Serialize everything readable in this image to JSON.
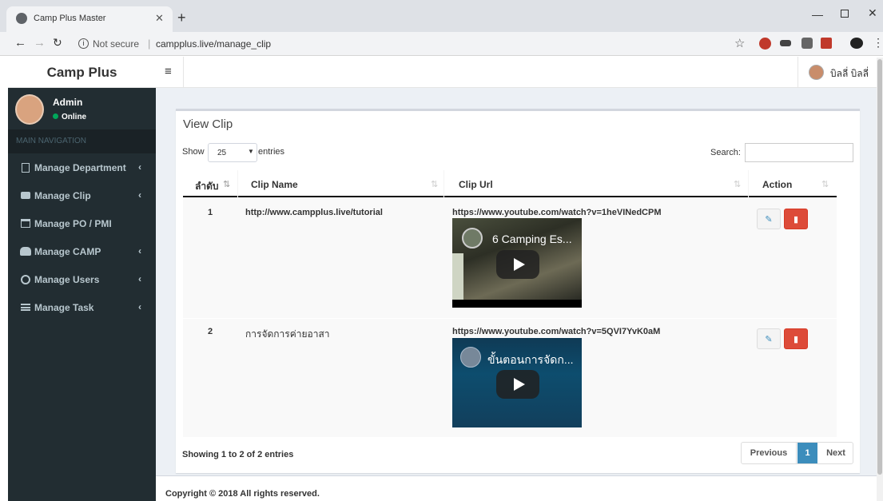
{
  "browser": {
    "tab_title": "Camp Plus Master",
    "url_prefix": "Not secure",
    "url": "campplus.live/manage_clip"
  },
  "app": {
    "logo": "Camp Plus",
    "user_name": "บิลลี่ บิลลี่",
    "sidebar_user": "Admin",
    "sidebar_status": "Online",
    "nav_header": "MAIN NAVIGATION",
    "nav_items": [
      {
        "label": "Manage Department",
        "icon": "building-icon"
      },
      {
        "label": "Manage Clip",
        "icon": "video-icon"
      },
      {
        "label": "Manage PO / PMI",
        "icon": "calendar-icon"
      },
      {
        "label": "Manage CAMP",
        "icon": "users-icon"
      },
      {
        "label": "Manage Users",
        "icon": "user-circle-icon"
      },
      {
        "label": "Manage Task",
        "icon": "list-icon"
      }
    ]
  },
  "page": {
    "title": "View Clip",
    "show_label": "Show",
    "page_size": "25",
    "entries_label": "entries",
    "search_label": "Search:",
    "search_value": "",
    "columns": [
      "ลำดับ",
      "Clip Name",
      "Clip Url",
      "Action"
    ],
    "rows": [
      {
        "num": "1",
        "name": "http://www.campplus.live/tutorial",
        "url": "https://www.youtube.com/watch?v=1heVINedCPM",
        "video_title": "6 Camping Es..."
      },
      {
        "num": "2",
        "name": "การจัดการค่ายอาสา",
        "url": "https://www.youtube.com/watch?v=5QVI7YvK0aM",
        "video_title": "ขั้นตอนการจัดก..."
      }
    ],
    "info": "Showing 1 to 2 of 2 entries",
    "pager": {
      "prev": "Previous",
      "current": "1",
      "next": "Next"
    },
    "footer": "Copyright © 2018 All rights reserved."
  },
  "colors": {
    "sidebar": "#222d32",
    "accent": "#3c8dbc",
    "danger": "#dd4b39",
    "online": "#00a65a"
  }
}
